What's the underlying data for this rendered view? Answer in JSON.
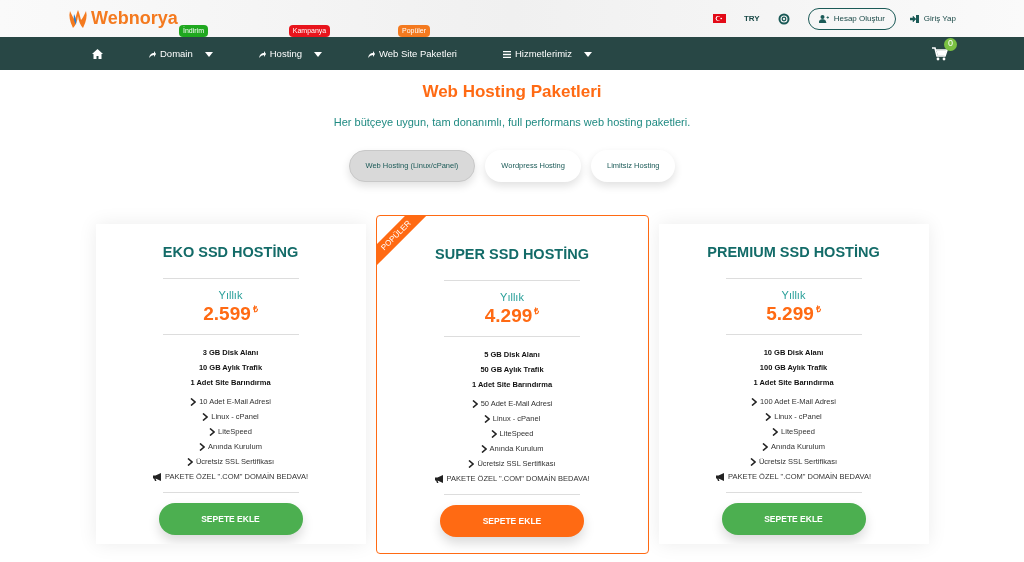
{
  "header": {
    "logo": "Webnorya",
    "currency": "TRY",
    "register": "Hesap Oluştur",
    "login": "Giriş Yap"
  },
  "nav": {
    "items": [
      {
        "kind": "home"
      },
      {
        "kind": "link",
        "label": "Domain",
        "dropdown": true,
        "badge": "İndirim",
        "color": "#1fa81f"
      },
      {
        "kind": "link",
        "label": "Hosting",
        "dropdown": true,
        "badge": "Kampanya",
        "color": "#e8141c"
      },
      {
        "kind": "link",
        "label": "Web Site Paketleri",
        "dropdown": false,
        "badge": "Popüler",
        "color": "#f47a1f"
      },
      {
        "kind": "menu",
        "label": "Hizmetlerimiz",
        "dropdown": true
      }
    ],
    "cart_count": "0"
  },
  "title": "Web Hosting Paketleri",
  "subtitle": "Her bütçeye uygun, tam donanımlı, full performans web hosting paketleri.",
  "tabs": [
    {
      "label": "Web Hosting (Linux/cPanel)",
      "selected": true
    },
    {
      "label": "Wordpress Hosting",
      "selected": false
    },
    {
      "label": "Limitsiz Hosting",
      "selected": false
    }
  ],
  "plans": [
    {
      "name": "EKO SSD HOSTİNG",
      "featured": false,
      "period": "Yıllık",
      "price": "2.599",
      "currency": "₺",
      "specs": [
        "3 GB Disk Alanı",
        "10 GB Aylık Trafik",
        "1 Adet Site Barındırma"
      ],
      "features": [
        "10 Adet E-Mail Adresi",
        "Linux - cPanel",
        "LiteSpeed",
        "Anında Kurulum",
        "Ücretsiz SSL Sertifikası"
      ],
      "promo": "PAKETE ÖZEL \".COM\" DOMAİN BEDAVA!",
      "button": "SEPETE EKLE"
    },
    {
      "name": "SUPER SSD HOSTİNG",
      "featured": true,
      "ribbon": "POPÜLER",
      "period": "Yıllık",
      "price": "4.299",
      "currency": "₺",
      "specs": [
        "5 GB Disk Alanı",
        "50 GB Aylık Trafik",
        "1 Adet Site Barındırma"
      ],
      "features": [
        "50 Adet E-Mail Adresi",
        "Linux - cPanel",
        "LiteSpeed",
        "Anında Kurulum",
        "Ücretsiz SSL Sertifikası"
      ],
      "promo": "PAKETE ÖZEL \".COM\" DOMAİN BEDAVA!",
      "button": "SEPETE EKLE"
    },
    {
      "name": "PREMIUM SSD HOSTİNG",
      "featured": false,
      "period": "Yıllık",
      "price": "5.299",
      "currency": "₺",
      "specs": [
        "10 GB Disk Alanı",
        "100 GB Aylık Trafik",
        "1 Adet Site Barındırma"
      ],
      "features": [
        "100 Adet E-Mail Adresi",
        "Linux - cPanel",
        "LiteSpeed",
        "Anında Kurulum",
        "Ücretsiz SSL Sertifikası"
      ],
      "promo": "PAKETE ÖZEL \".COM\" DOMAİN BEDAVA!",
      "button": "SEPETE EKLE"
    }
  ]
}
